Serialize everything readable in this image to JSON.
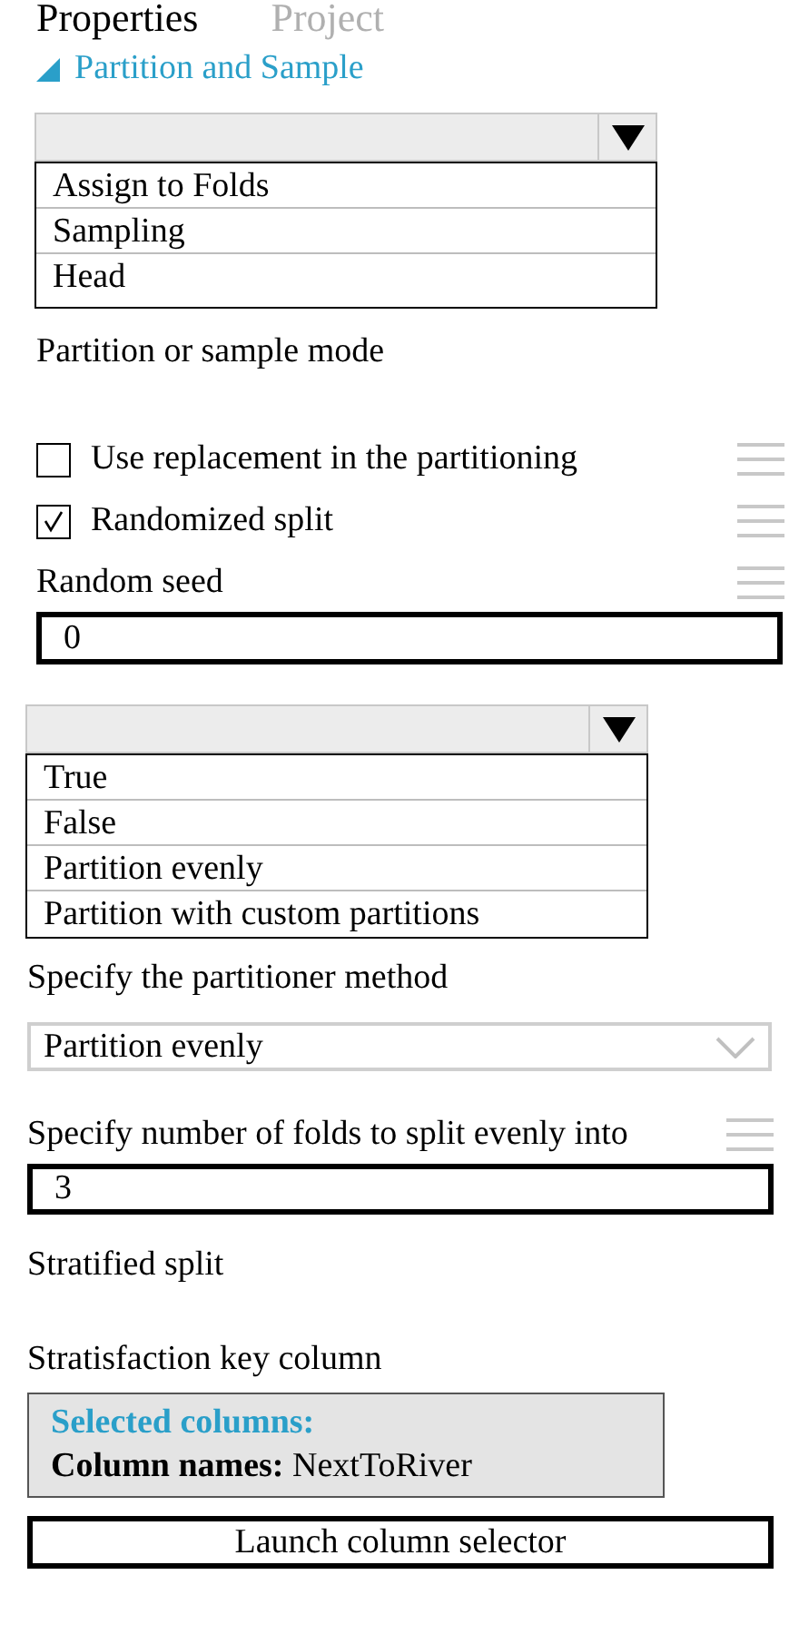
{
  "tabs": [
    {
      "label": "Properties",
      "selected": true
    },
    {
      "label": "Project",
      "selected": false
    }
  ],
  "section": {
    "title": "Partition and Sample",
    "expanded": true
  },
  "mode_dropdown": {
    "options": [
      "Assign to Folds",
      "Sampling",
      "Head"
    ]
  },
  "mode_label": "Partition or sample mode",
  "checkboxes": [
    {
      "label": "Use replacement in the partitioning",
      "checked": false
    },
    {
      "label": "Randomized split",
      "checked": true
    }
  ],
  "random_seed": {
    "label": "Random seed",
    "value": "0"
  },
  "partitioner_dropdown": {
    "options": [
      "True",
      "False",
      "Partition evenly",
      "Partition with custom partitions"
    ]
  },
  "partitioner_label": "Specify the partitioner method",
  "partitioner_select": {
    "value": "Partition evenly"
  },
  "folds": {
    "label": "Specify number of folds to split evenly into",
    "value": "3"
  },
  "stratified_split_label": "Stratified split",
  "strat_key_label": "Stratisfaction key column",
  "selected_columns": {
    "title": "Selected columns:",
    "names": "**Column names:** NextToRiver"
  },
  "launch_button": "Launch column selector"
}
